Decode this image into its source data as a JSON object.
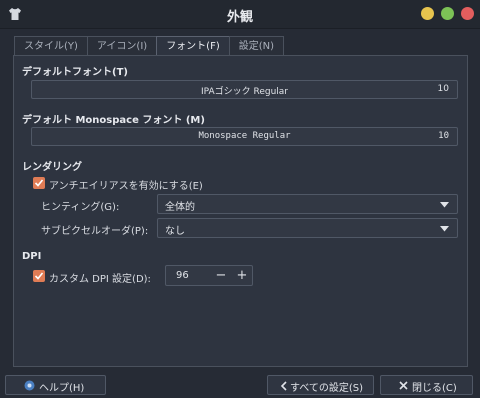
{
  "window": {
    "title": "外観"
  },
  "tabs": [
    {
      "label": "スタイル(Y)",
      "active": false
    },
    {
      "label": "アイコン(I)",
      "active": false
    },
    {
      "label": "フォント(F)",
      "active": true
    },
    {
      "label": "設定(N)",
      "active": false
    }
  ],
  "default_font": {
    "label": "デフォルトフォント(T)",
    "name": "IPAゴシック Regular",
    "size": "10"
  },
  "mono_font": {
    "label": "デフォルト Monospace フォント (M)",
    "name": "Monospace Regular",
    "size": "10"
  },
  "rendering": {
    "label": "レンダリング",
    "antialias_label": "アンチエイリアスを有効にする(E)",
    "antialias_checked": true,
    "hinting_label": "ヒンティング(G):",
    "hinting_value": "全体的",
    "subpixel_label": "サブピクセルオーダ(P):",
    "subpixel_value": "なし"
  },
  "dpi": {
    "label": "DPI",
    "custom_label": "カスタム DPI 設定(D):",
    "custom_checked": true,
    "value": "96"
  },
  "buttons": {
    "help": "ヘルプ(H)",
    "all_settings": "すべての設定(S)",
    "close": "閉じる(C)"
  },
  "colors": {
    "accent": "#e07c55",
    "minimize": "#e7c44e",
    "maximize": "#7cc256",
    "close": "#e35e5e"
  }
}
